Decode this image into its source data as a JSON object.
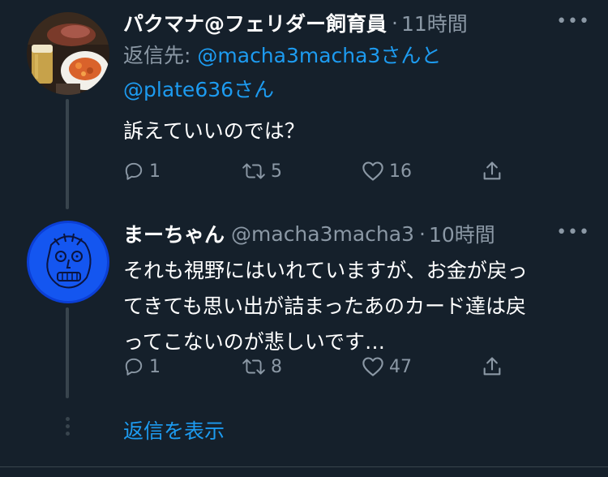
{
  "theme": {
    "background": "#15202b",
    "text_primary": "#ffffff",
    "text_secondary": "#8b98a5",
    "accent": "#1d9bf0",
    "divider": "#38444d"
  },
  "tweets": [
    {
      "display_name": "パクマナ@フェリダー飼育員",
      "handle": "",
      "time": "11時間",
      "replying_label": "返信先:",
      "replying_mentions_1": "@macha3macha3さんと",
      "replying_mentions_2": "@plate636さん",
      "text_lines": [
        "訴えていいのでは？"
      ],
      "avatar_icon": "food-photo-avatar",
      "reply_count": "1",
      "retweet_count": "5",
      "like_count": "16"
    },
    {
      "display_name": "まーちゃん",
      "handle": "@macha3macha3",
      "time": "10時間",
      "text_lines": [
        "それも視野にはいれていますが、お金が戻っ",
        "てきても思い出が詰まったあのカード達は戻",
        "ってこないのが悲しいです…"
      ],
      "avatar_icon": "blue-drawing-avatar",
      "reply_count": "1",
      "retweet_count": "8",
      "like_count": "47"
    }
  ],
  "show_replies_label": "返信を表示",
  "icons": {
    "reply": "reply-icon",
    "retweet": "retweet-icon",
    "like": "heart-icon",
    "share": "share-icon",
    "more": "more-dots-icon"
  }
}
